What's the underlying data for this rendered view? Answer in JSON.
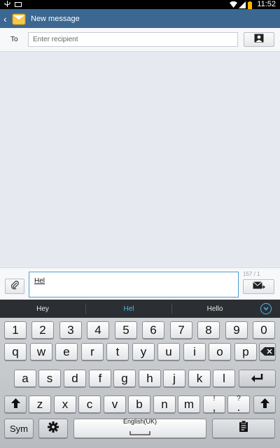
{
  "status": {
    "time": "11:52"
  },
  "actionbar": {
    "title": "New message"
  },
  "recipient": {
    "label": "To",
    "placeholder": "Enter recipient"
  },
  "compose": {
    "text": "Hel",
    "counter": "157 / 1"
  },
  "suggestions": [
    "Hey",
    "Hel",
    "Hello"
  ],
  "keyboard": {
    "row_numbers": [
      "1",
      "2",
      "3",
      "4",
      "5",
      "6",
      "7",
      "8",
      "9",
      "0"
    ],
    "row_top": [
      "q",
      "w",
      "e",
      "r",
      "t",
      "y",
      "u",
      "i",
      "o",
      "p"
    ],
    "row_mid": [
      "a",
      "s",
      "d",
      "f",
      "g",
      "h",
      "j",
      "k",
      "l"
    ],
    "row_bot": [
      "z",
      "x",
      "c",
      "v",
      "b",
      "n",
      "m"
    ],
    "punct1_main": ",",
    "punct1_sub": "!",
    "punct2_main": ".",
    "punct2_sub": "?",
    "sym_label": "Sym",
    "space_label": "English(UK)"
  },
  "colors": {
    "actionbar": "#3b6791",
    "accent": "#52b4e8",
    "suggest_bg": "#2b2f33"
  }
}
